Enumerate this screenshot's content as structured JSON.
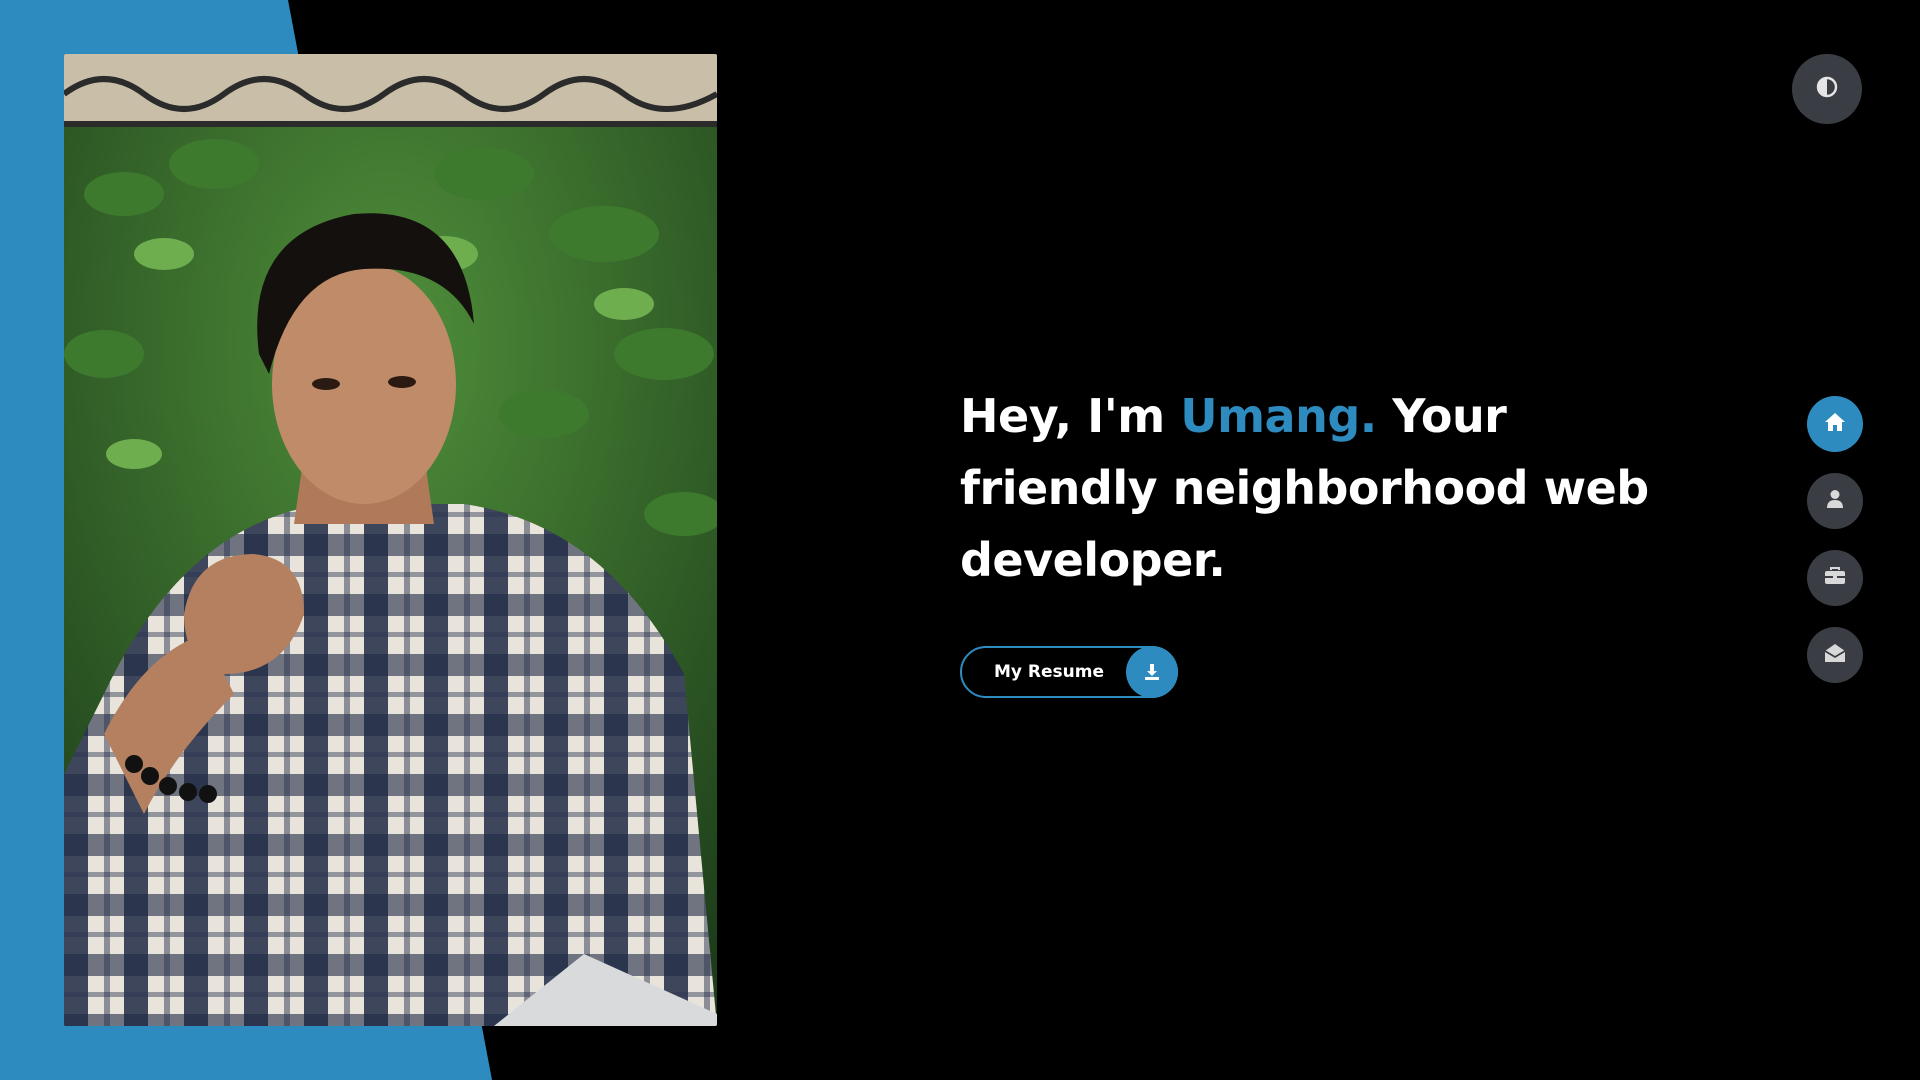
{
  "colors": {
    "accent": "#2e8bc0",
    "background": "#000000",
    "nav_inactive": "#3a3e44",
    "text": "#ffffff"
  },
  "hero": {
    "greeting": "Hey, I'm ",
    "name": "Umang.",
    "tagline": " Your friendly neighborhood web developer."
  },
  "resume_button": {
    "label": "My Resume",
    "icon": "download-icon"
  },
  "theme_toggle": {
    "icon": "contrast-icon"
  },
  "side_nav": {
    "items": [
      {
        "icon": "home-icon",
        "active": true
      },
      {
        "icon": "user-icon",
        "active": false
      },
      {
        "icon": "briefcase-icon",
        "active": false
      },
      {
        "icon": "envelope-open-icon",
        "active": false
      }
    ]
  },
  "profile_photo": {
    "subject": "portrait-photo"
  }
}
